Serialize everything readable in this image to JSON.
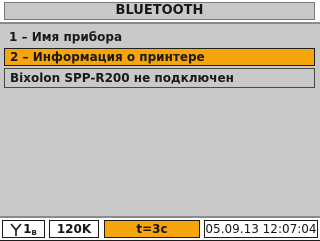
{
  "title": "BLUETOOTH",
  "menu": {
    "items": [
      {
        "label": "1 – Имя прибора"
      },
      {
        "label": "2 – Информация о принтере"
      }
    ]
  },
  "status_message": "Bixolon SPP-R200 не подключен",
  "status_bar": {
    "antenna_level": "1",
    "antenna_sub": "B",
    "speed": "120K",
    "timer": "t=3c",
    "datetime": "05.09.13 12:07:04"
  },
  "colors": {
    "highlight": "#f7a50c",
    "background": "#c9c9c9"
  },
  "icons": {
    "antenna": "antenna-icon"
  }
}
